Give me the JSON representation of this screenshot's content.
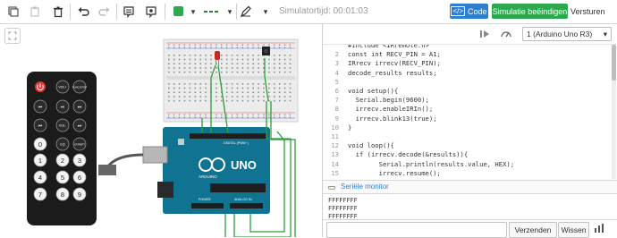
{
  "toolbar": {
    "sim_time_label": "Simulatortijd: 00:01:03",
    "code_label": "Code",
    "simulate_label": "Simulatie beëindigen",
    "send_label": "Versturen"
  },
  "code_editor": {
    "board_select": "1 (Arduino Uno R3)",
    "lines": [
      {
        "n": "",
        "t": "#include <IRremote.h>"
      },
      {
        "n": "2",
        "t": "const int RECV_PIN = A1;"
      },
      {
        "n": "3",
        "t": "IRrecv irrecv(RECV_PIN);"
      },
      {
        "n": "4",
        "t": "decode_results results;"
      },
      {
        "n": "5",
        "t": ""
      },
      {
        "n": "6",
        "t": "void setup(){"
      },
      {
        "n": "7",
        "t": "  Serial.begin(9600);"
      },
      {
        "n": "8",
        "t": "  irrecv.enableIRIn();"
      },
      {
        "n": "9",
        "t": "  irrecv.blink13(true);"
      },
      {
        "n": "10",
        "t": "}"
      },
      {
        "n": "11",
        "t": ""
      },
      {
        "n": "12",
        "t": "void loop(){"
      },
      {
        "n": "13",
        "t": "  if (irrecv.decode(&results)){"
      },
      {
        "n": "14",
        "t": "        Serial.println(results.value, HEX);"
      },
      {
        "n": "15",
        "t": "        irrecv.resume();"
      }
    ]
  },
  "serial": {
    "title": "Seriële monitor",
    "output": [
      "FFFFFFFF",
      "FFFFFFFF",
      "FFFFFFFF"
    ],
    "send_button": "Verzenden",
    "clear_button": "Wissen"
  },
  "remote": {
    "buttons": [
      "VOL+",
      "FUNC/STOP",
      "VOL-",
      "EQ",
      "ST/REPT",
      "0",
      "1",
      "2",
      "3",
      "4",
      "5",
      "6",
      "7",
      "8",
      "9"
    ]
  },
  "arduino": {
    "label": "UNO",
    "brand": "ARDUINO",
    "digital_label": "DIGITAL (PWM~)",
    "power_label": "POWER",
    "analog_label": "ANALOG IN"
  },
  "colors": {
    "accent_blue": "#2f7fd1",
    "accent_green": "#2ea84e",
    "board_teal": "#0f7391",
    "wire_green": "#2e9e3a"
  }
}
